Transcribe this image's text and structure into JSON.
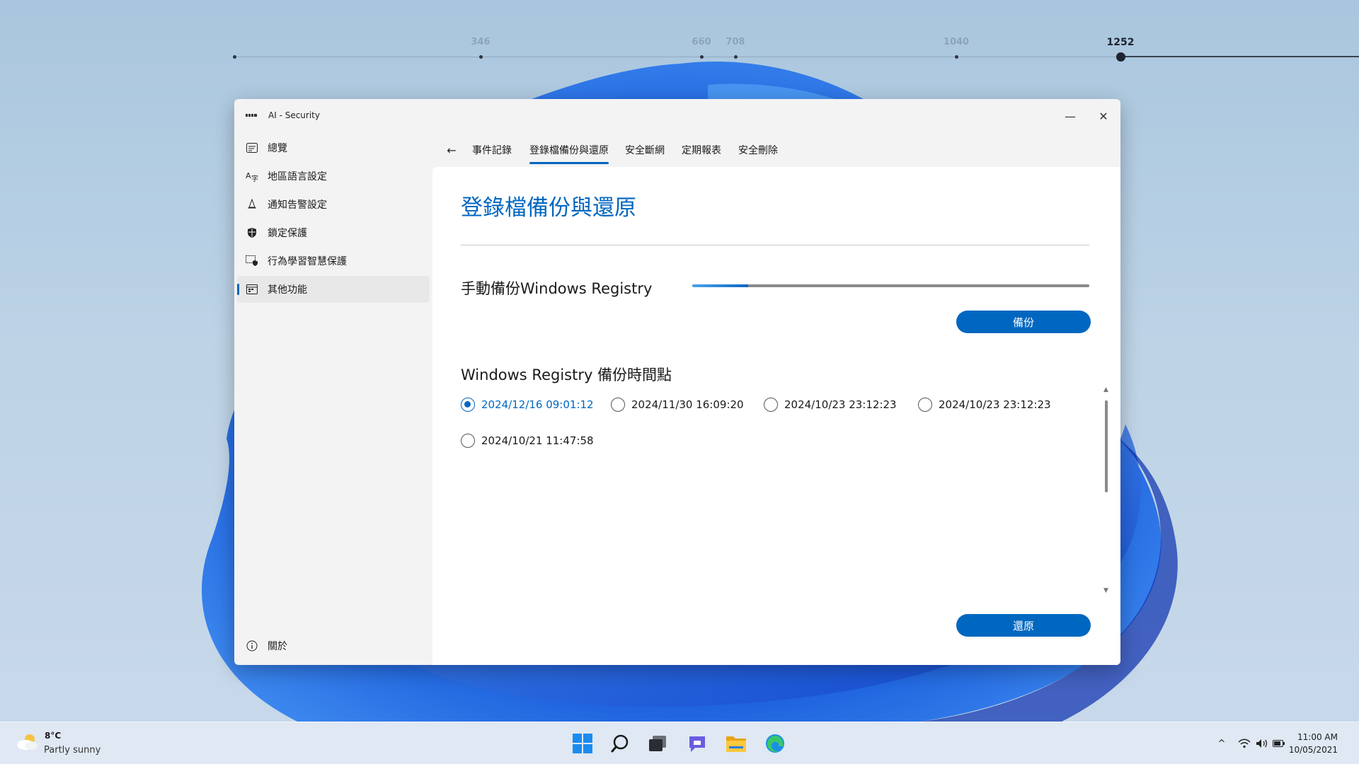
{
  "timeline": {
    "marks": [
      "346",
      "660",
      "708",
      "1040",
      "1252"
    ],
    "active": "1252"
  },
  "window": {
    "title": "AI - Security",
    "minimize_glyph": "—",
    "close_glyph": "✕"
  },
  "sidebar": {
    "items": [
      {
        "label": "總覽",
        "icon": "overview-icon"
      },
      {
        "label": "地區語言設定",
        "icon": "language-icon"
      },
      {
        "label": "通知告警設定",
        "icon": "notification-icon"
      },
      {
        "label": "鎖定保護",
        "icon": "shield-icon"
      },
      {
        "label": "行為學習智慧保護",
        "icon": "behavior-learning-icon"
      },
      {
        "label": "其他功能",
        "icon": "other-features-icon"
      }
    ],
    "active_index": 5,
    "footer": {
      "label": "關於",
      "icon": "info-icon"
    }
  },
  "tabs": {
    "back_glyph": "←",
    "items": [
      "事件記錄",
      "登錄檔備份與還原",
      "安全斷網",
      "定期報表",
      "安全刪除"
    ],
    "active_index": 1
  },
  "main": {
    "page_title": "登錄檔備份與還原",
    "manual_backup_label": "手動備份Windows Registry",
    "backup_progress_percent": 14,
    "backup_button": "備份",
    "restore_points_label": "Windows Registry 備份時間點",
    "restore_points": [
      "2024/12/16 09:01:12",
      "2024/11/30 16:09:20",
      "2024/10/23 23:12:23",
      "2024/10/23 23:12:23",
      "2024/10/21 11:47:58"
    ],
    "selected_restore_point": 0,
    "restore_button": "還原",
    "scroll_up_glyph": "▲",
    "scroll_down_glyph": "▼"
  },
  "taskbar": {
    "weather": {
      "temp": "8°C",
      "description": "Partly sunny"
    },
    "apps": [
      "windows-start-icon",
      "search-icon",
      "task-view-icon",
      "chat-icon",
      "file-explorer-icon",
      "edge-browser-icon"
    ],
    "tray": {
      "chevron": "^"
    },
    "clock": {
      "time": "11:00 AM",
      "date": "10/05/2021"
    }
  },
  "colors": {
    "accent": "#0067c0",
    "wallpaper_blue": "#1456d8"
  }
}
